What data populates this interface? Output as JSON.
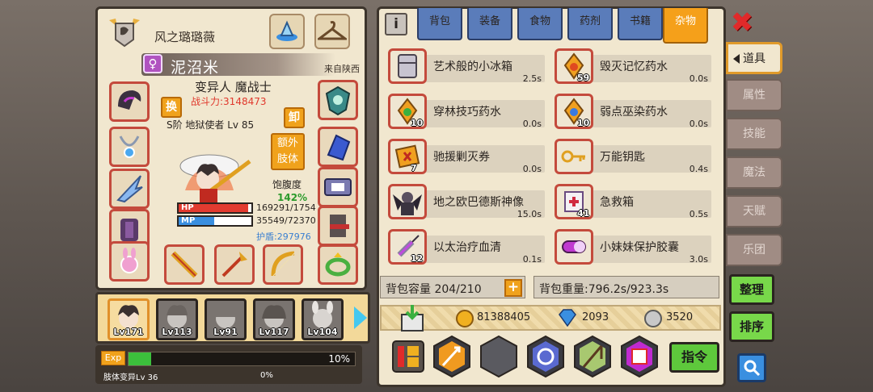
{
  "character": {
    "owner_name": "风之璐璐薇",
    "name": "泥沼米",
    "gender_symbol": "♀",
    "origin": "来自陕西",
    "class": "变异人 魔战士",
    "power": "战斗力:3148473",
    "rank": "S阶 地狱使者 Lv 85",
    "swap_label": "换",
    "unequip_label": "卸",
    "extra_limb_label": "额外\n肢体",
    "satiety_label": "饱腹度",
    "satiety_value": "142%",
    "hp_label": "HP",
    "mp_label": "MP",
    "hp_text": "169291/1754",
    "mp_text": "35549/72370",
    "hp_fraction": 0.96,
    "mp_fraction": 0.49,
    "shield_text": "护盾:297976"
  },
  "party": [
    {
      "level": "Lv171",
      "active": true
    },
    {
      "level": "Lv113",
      "active": false
    },
    {
      "level": "Lv91",
      "active": false
    },
    {
      "level": "Lv117",
      "active": false
    },
    {
      "level": "Lv104",
      "active": false
    }
  ],
  "exp": {
    "tag": "Exp",
    "percent_text": "10%",
    "fraction": 0.1,
    "mutation_label": "肢体变异Lv 36",
    "mutation_percent": "0%"
  },
  "inventory": {
    "info_icon": "i",
    "tabs": [
      {
        "label": "背包",
        "active": false
      },
      {
        "label": "装备",
        "active": false
      },
      {
        "label": "食物",
        "active": false
      },
      {
        "label": "药剂",
        "active": false
      },
      {
        "label": "书籍",
        "active": false
      },
      {
        "label": "杂物",
        "active": true
      }
    ],
    "close_icon": "✖",
    "items": [
      {
        "name": "艺术般的小冰箱",
        "weight": "2.5s",
        "count": "",
        "icon": "fridge-icon"
      },
      {
        "name": "毁灭记忆药水",
        "weight": "0.0s",
        "count": "59",
        "icon": "potion-icon"
      },
      {
        "name": "穿林技巧药水",
        "weight": "0.0s",
        "count": "10",
        "icon": "potion-icon"
      },
      {
        "name": "弱点巫染药水",
        "weight": "0.0s",
        "count": "10",
        "icon": "potion-icon"
      },
      {
        "name": "驰援剿灭券",
        "weight": "0.0s",
        "count": "7",
        "icon": "ticket-icon"
      },
      {
        "name": "万能钥匙",
        "weight": "0.4s",
        "count": "",
        "icon": "key-icon"
      },
      {
        "name": "地之欧巴德斯神像",
        "weight": "15.0s",
        "count": "",
        "icon": "statue-icon"
      },
      {
        "name": "急救箱",
        "weight": "0.5s",
        "count": "41",
        "icon": "firstaid-icon"
      },
      {
        "name": "以太治疗血清",
        "weight": "0.1s",
        "count": "12",
        "icon": "syringe-icon"
      },
      {
        "name": "小妹妹保护胶囊",
        "weight": "3.0s",
        "count": "",
        "icon": "capsule-icon"
      }
    ],
    "capacity_text": "背包容量 204/210",
    "capacity_plus": "+",
    "weight_text": "背包重量:796.2s/923.3s",
    "gold": "81388405",
    "diamonds": "2093",
    "silver": "3520",
    "command_label": "指令"
  },
  "side_tabs": [
    {
      "label": "道具",
      "active": true
    },
    {
      "label": "属性",
      "active": false
    },
    {
      "label": "技能",
      "active": false
    },
    {
      "label": "魔法",
      "active": false
    },
    {
      "label": "天赋",
      "active": false
    },
    {
      "label": "乐团",
      "active": false
    }
  ],
  "buttons": {
    "organize": "整理",
    "sort": "排序"
  },
  "colors": {
    "panel": "#f1e7cf",
    "active_tab": "#f5a01a",
    "inactive_tab": "#5a7cba",
    "slot_border": "#c44a3c",
    "hp": "#e23b30",
    "mp": "#3a8fe0",
    "exp": "#3cc03c"
  }
}
